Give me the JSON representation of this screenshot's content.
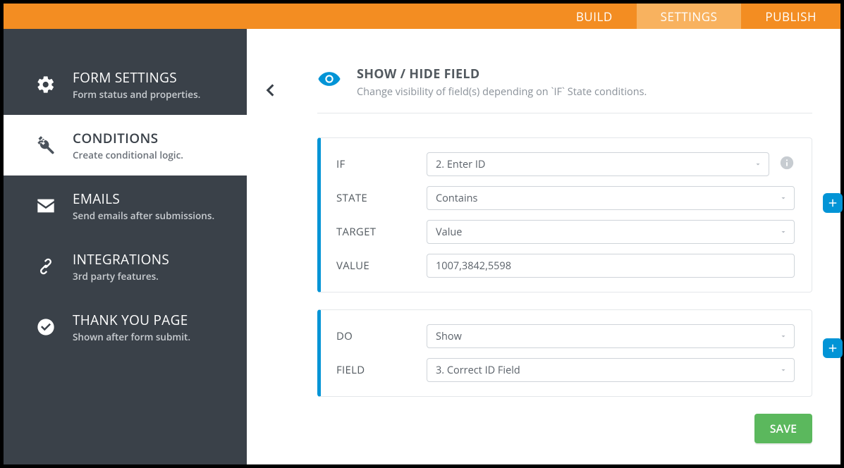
{
  "topbar": {
    "tabs": [
      {
        "label": "BUILD",
        "active": false
      },
      {
        "label": "SETTINGS",
        "active": true
      },
      {
        "label": "PUBLISH",
        "active": false
      }
    ]
  },
  "sidebar": {
    "items": [
      {
        "title": "FORM SETTINGS",
        "sub": "Form status and properties.",
        "icon": "gear",
        "active": false
      },
      {
        "title": "CONDITIONS",
        "sub": "Create conditional logic.",
        "icon": "tools",
        "active": true
      },
      {
        "title": "EMAILS",
        "sub": "Send emails after submissions.",
        "icon": "envelope",
        "active": false
      },
      {
        "title": "INTEGRATIONS",
        "sub": "3rd party features.",
        "icon": "link",
        "active": false
      },
      {
        "title": "THANK YOU PAGE",
        "sub": "Shown after form submit.",
        "icon": "check",
        "active": false
      }
    ]
  },
  "header": {
    "title": "SHOW / HIDE FIELD",
    "sub": "Change visibility of field(s) depending on `IF` State conditions."
  },
  "condition": {
    "if_label": "IF",
    "if_value": "2. Enter ID",
    "state_label": "STATE",
    "state_value": "Contains",
    "target_label": "TARGET",
    "target_value": "Value",
    "value_label": "VALUE",
    "value_input": "1007,3842,5598"
  },
  "action": {
    "do_label": "DO",
    "do_value": "Show",
    "field_label": "FIELD",
    "field_value": "3. Correct ID Field"
  },
  "buttons": {
    "save": "SAVE"
  }
}
